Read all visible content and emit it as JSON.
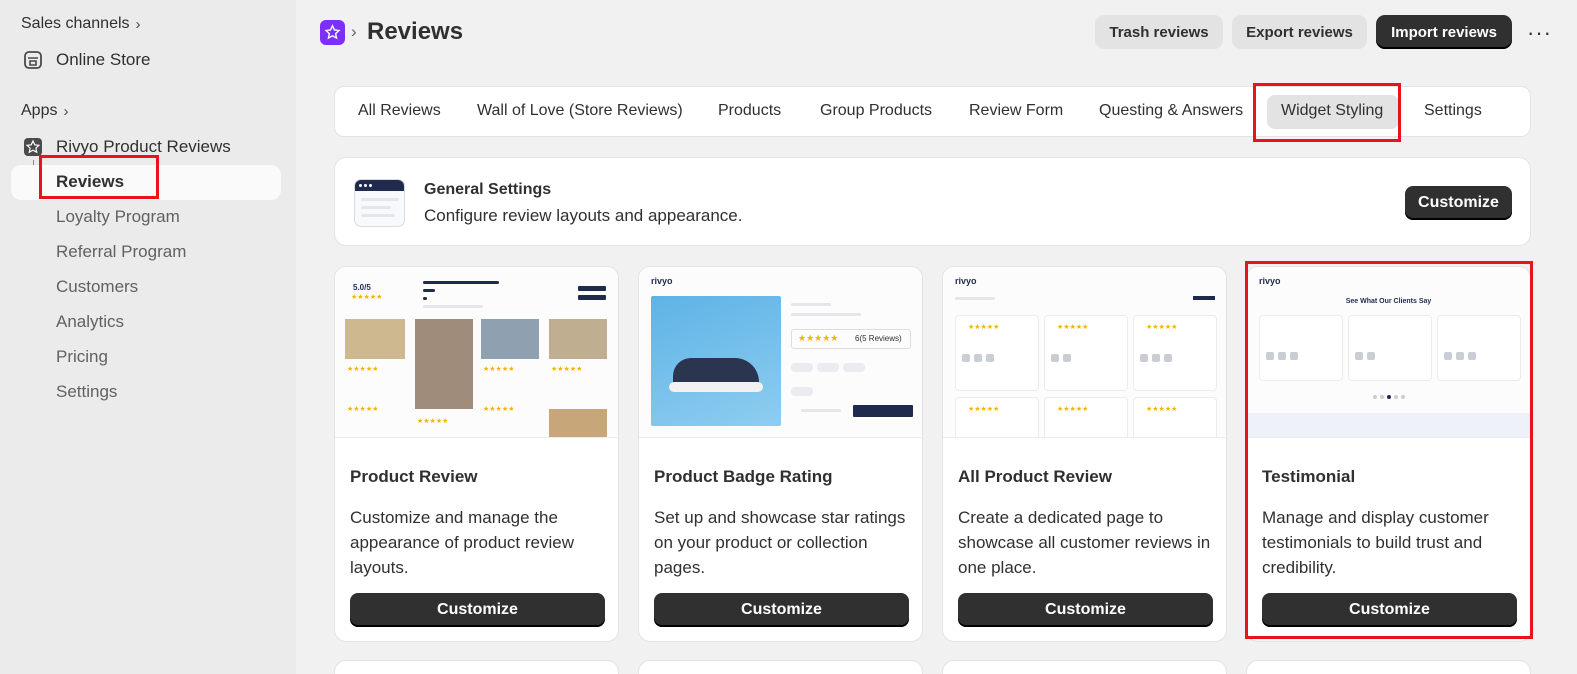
{
  "sidebar": {
    "sales_channels_label": "Sales channels",
    "online_store_label": "Online Store",
    "apps_label": "Apps",
    "app_name": "Rivyo Product Reviews",
    "active_item": "Reviews",
    "items": [
      "Loyalty Program",
      "Referral Program",
      "Customers",
      "Analytics",
      "Pricing",
      "Settings"
    ]
  },
  "header": {
    "title": "Reviews",
    "trash_label": "Trash reviews",
    "export_label": "Export reviews",
    "import_label": "Import reviews",
    "more_label": "···"
  },
  "tabs": [
    {
      "label": "All Reviews"
    },
    {
      "label": "Wall of Love (Store Reviews)"
    },
    {
      "label": "Products"
    },
    {
      "label": "Group Products"
    },
    {
      "label": "Review Form"
    },
    {
      "label": "Questing & Answers"
    },
    {
      "label": "Widget Styling",
      "active": true
    },
    {
      "label": "Settings"
    }
  ],
  "general": {
    "title": "General Settings",
    "description": "Configure review layouts and appearance.",
    "button": "Customize"
  },
  "cards": [
    {
      "title": "Product Review",
      "description": "Customize and manage the appearance of product review layouts.",
      "button": "Customize"
    },
    {
      "title": "Product Badge Rating",
      "description": "Set up and showcase star ratings on your product or collection pages.",
      "button": "Customize"
    },
    {
      "title": "All Product Review",
      "description": "Create a dedicated page to showcase all customer reviews in one place.",
      "button": "Customize"
    },
    {
      "title": "Testimonial",
      "description": "Manage and display customer testimonials to build trust and credibility.",
      "button": "Customize"
    }
  ],
  "previews": {
    "score": "5.0/5",
    "brand": "rivyo",
    "badge_reviews": "6(5 Reviews)",
    "testimonial_heading": "See What Our Clients Say"
  },
  "colors": {
    "accent_purple": "#7b2ff7",
    "highlight_red": "#e8131b",
    "button_dark": "#303030",
    "star": "#f5b400"
  }
}
